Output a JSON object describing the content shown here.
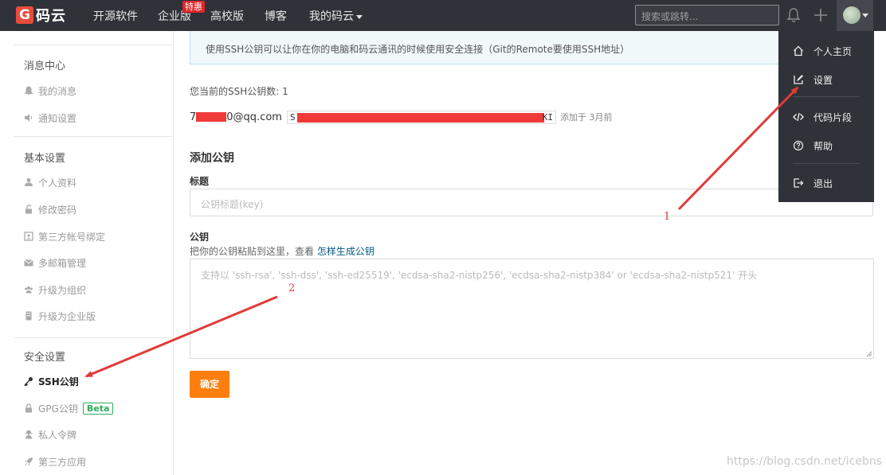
{
  "nav": {
    "logo_glyph": "G",
    "logo_text": "码云",
    "items": [
      "开源软件",
      "企业版",
      "高校版",
      "博客"
    ],
    "my_gitee": "我的码云",
    "badge": "特惠",
    "search_placeholder": "搜索或跳转..."
  },
  "sidebar": {
    "sections": [
      {
        "title": "消息中心",
        "items": [
          "我的消息",
          "通知设置"
        ]
      },
      {
        "title": "基本设置",
        "items": [
          "个人资料",
          "修改密码",
          "第三方帐号绑定",
          "多邮箱管理",
          "升级为组织",
          "升级为企业版"
        ]
      },
      {
        "title": "安全设置",
        "items": [
          "SSH公钥",
          "GPG公钥",
          "私人令牌",
          "第三方应用"
        ]
      }
    ],
    "beta_label": "Beta"
  },
  "main": {
    "info": "使用SSH公钥可以让你在你的电脑和码云通讯的时候使用安全连接（Git的Remote要使用SSH地址）",
    "key_count": "您当前的SSH公钥数: 1",
    "key_email_prefix": "7",
    "key_email_suffix": "0@qq.com",
    "key_fp_start": "S",
    "key_fp_end": "KI",
    "key_added": "添加于 3月前",
    "add_heading": "添加公钥",
    "title_label": "标题",
    "title_placeholder": "公钥标题(key)",
    "key_label": "公钥",
    "hint_text": "把你的公钥粘贴到这里，查看 ",
    "hint_link": "怎样生成公钥",
    "key_placeholder": "支持以 'ssh-rsa', 'ssh-dss', 'ssh-ed25519', 'ecdsa-sha2-nistp256', 'ecdsa-sha2-nistp384' or 'ecdsa-sha2-nistp521' 开头",
    "confirm": "确定"
  },
  "dropdown": {
    "items": [
      "个人主页",
      "设置",
      "代码片段",
      "帮助",
      "退出"
    ]
  },
  "annotations": [
    "1",
    "2"
  ],
  "watermark": "https://blog.csdn.net/icebns",
  "colors": {
    "nav_bg": "#2f3238",
    "accent_orange": "#ff7f0e",
    "annotation_red": "#e03a3a",
    "beta_green": "#2eaa5c"
  }
}
